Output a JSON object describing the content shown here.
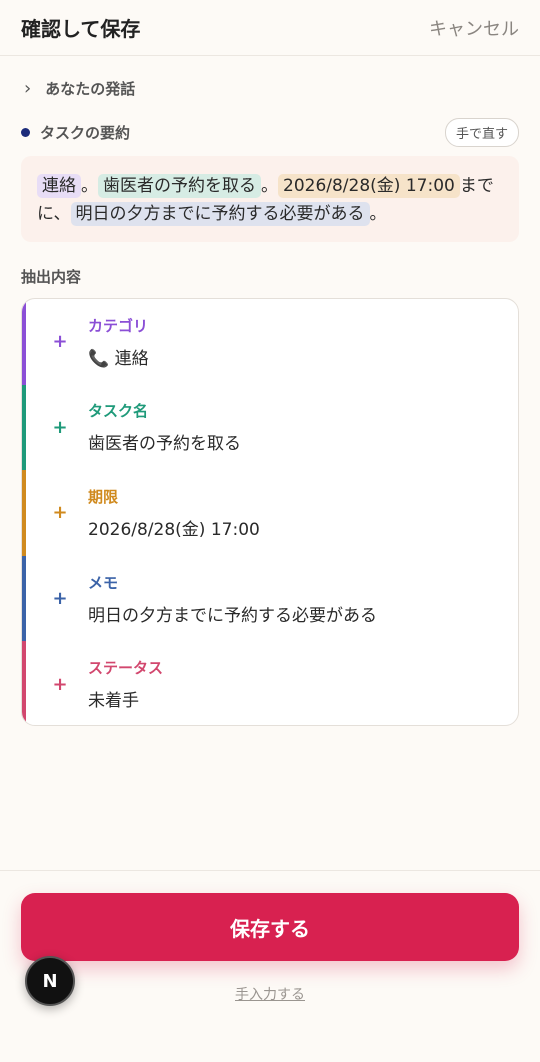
{
  "header": {
    "title": "確認して保存",
    "cancel_label": "キャンセル"
  },
  "utterance": {
    "chevron": "›",
    "label": "あなたの発話"
  },
  "summary": {
    "label": "タスクの要約",
    "fix_label": "手で直す",
    "segments": {
      "s1": "連絡",
      "t1": "。",
      "s2": "歯医者の予約を取る",
      "t2": "。",
      "s3": "2026/8/28(金) 17:00",
      "t3": "までに、",
      "s4": "明日の夕方までに予約する必要がある",
      "t4": "。"
    }
  },
  "extracted": {
    "label": "抽出内容",
    "fields": [
      {
        "label": "カテゴリ",
        "value": "📞 連絡",
        "color": "#8b4fd6"
      },
      {
        "label": "タスク名",
        "value": "歯医者の予約を取る",
        "color": "#1f9a7a"
      },
      {
        "label": "期限",
        "value": "2026/8/28(金) 17:00",
        "color": "#d08a1e"
      },
      {
        "label": "メモ",
        "value": "明日の夕方までに予約する必要がある",
        "color": "#3b63a8"
      },
      {
        "label": "ステータス",
        "value": "未着手",
        "color": "#d2476e"
      }
    ],
    "plus_glyph": "+"
  },
  "actions": {
    "save_label": "保存する",
    "manual_label": "手入力する"
  },
  "badge": {
    "letter": "N"
  },
  "colors": {
    "accent": "#d82150",
    "summary_bg": "#fcf1ec",
    "dot": "#1c2b7a"
  }
}
